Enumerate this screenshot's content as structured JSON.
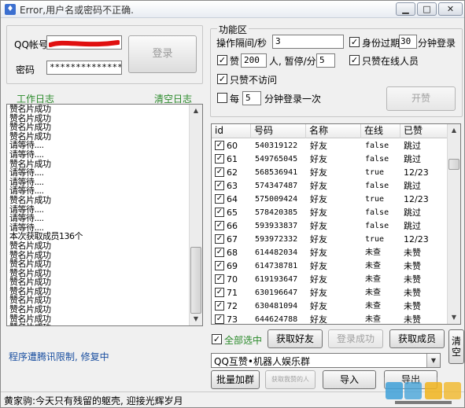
{
  "window": {
    "title": "Error,用户名或密码不正确.",
    "min_glyph": "▁",
    "max_glyph": "□",
    "close_glyph": "✕"
  },
  "login": {
    "qq_label": "QQ帐号",
    "password_label": "密码",
    "password_value": "****************",
    "login_button": "登录"
  },
  "log": {
    "title": "工作日志",
    "clear_label": "清空日志",
    "lines": [
      "赞名片成功",
      "赞名片成功",
      "赞名片成功",
      "赞名片成功",
      "请等待....",
      "请等待....",
      "赞名片成功",
      "请等待....",
      "请等待....",
      "请等待....",
      "赞名片成功",
      "请等待....",
      "请等待....",
      "请等待....",
      "本次获取成员136个",
      "赞名片成功",
      "赞名片成功",
      "赞名片成功",
      "赞名片成功",
      "赞名片成功",
      "赞名片成功",
      "赞名片成功",
      "赞名片成功",
      "赞名片成功",
      "赞名片成功",
      "赞名片成功",
      "赞名片成功",
      "赞名片成功",
      "赞名片成功"
    ],
    "status_note": "程序遭腾讯限制, 修复中"
  },
  "func": {
    "title": "功能区",
    "interval_label": "操作隔间/秒",
    "interval_value": "3",
    "expire_check": "✓",
    "expire_label": "身份过期",
    "expire_value": "30",
    "expire_suffix": "分钟登录",
    "like_check": "✓",
    "like_label": "赞",
    "like_value": "200",
    "pause_label": "人, 暂停/分",
    "pause_value": "5",
    "online_check": "✓",
    "online_label": "只赞在线人员",
    "nonvisit_check": "✓",
    "nonvisit_label": "只赞不访问",
    "every_check": "",
    "every_label": "每",
    "every_value": "5",
    "every_suffix": "分钟登录一次",
    "start_button": "开赞"
  },
  "table": {
    "headers": [
      "id",
      "号码",
      "名称",
      "在线",
      "已赞"
    ],
    "rows": [
      {
        "id": "60",
        "qq": "540319122",
        "name": "好友",
        "online": "false",
        "liked": "跳过"
      },
      {
        "id": "61",
        "qq": "549765045",
        "name": "好友",
        "online": "false",
        "liked": "跳过"
      },
      {
        "id": "62",
        "qq": "568536941",
        "name": "好友",
        "online": "true",
        "liked": "12/23"
      },
      {
        "id": "63",
        "qq": "574347487",
        "name": "好友",
        "online": "false",
        "liked": "跳过"
      },
      {
        "id": "64",
        "qq": "575009424",
        "name": "好友",
        "online": "true",
        "liked": "12/23"
      },
      {
        "id": "65",
        "qq": "578420385",
        "name": "好友",
        "online": "false",
        "liked": "跳过"
      },
      {
        "id": "66",
        "qq": "593933837",
        "name": "好友",
        "online": "false",
        "liked": "跳过"
      },
      {
        "id": "67",
        "qq": "593972332",
        "name": "好友",
        "online": "true",
        "liked": "12/23"
      },
      {
        "id": "68",
        "qq": "614482034",
        "name": "好友",
        "online": "未查",
        "liked": "未赞"
      },
      {
        "id": "69",
        "qq": "614738781",
        "name": "好友",
        "online": "未查",
        "liked": "未赞"
      },
      {
        "id": "70",
        "qq": "619193647",
        "name": "好友",
        "online": "未查",
        "liked": "未赞"
      },
      {
        "id": "71",
        "qq": "630196647",
        "name": "好友",
        "online": "未查",
        "liked": "未赞"
      },
      {
        "id": "72",
        "qq": "630481094",
        "name": "好友",
        "online": "未查",
        "liked": "未赞"
      },
      {
        "id": "73",
        "qq": "644624788",
        "name": "好友",
        "online": "未查",
        "liked": "未赞"
      }
    ],
    "row_check": "✓"
  },
  "actions": {
    "select_all_check": "✓",
    "select_all_label": "全部选中",
    "get_friends": "获取好友",
    "login_success": "登录成功",
    "get_members": "获取成员",
    "clear": "清空",
    "group_value": "QQ互赞•机器人娱乐群",
    "batch_add": "批量加群",
    "get_liked": "获取我赞的人",
    "import": "导入",
    "export": "导出"
  },
  "status": {
    "text": "黄家驹:今天只有残留的躯壳, 迎接光辉岁月"
  },
  "colors": {
    "accent_green": "#2a8a2a",
    "note_blue": "#1a4fa0",
    "redaction_red": "#e01010"
  },
  "icons": {
    "app": "app-icon",
    "dropdown": "chevron-down-icon"
  }
}
